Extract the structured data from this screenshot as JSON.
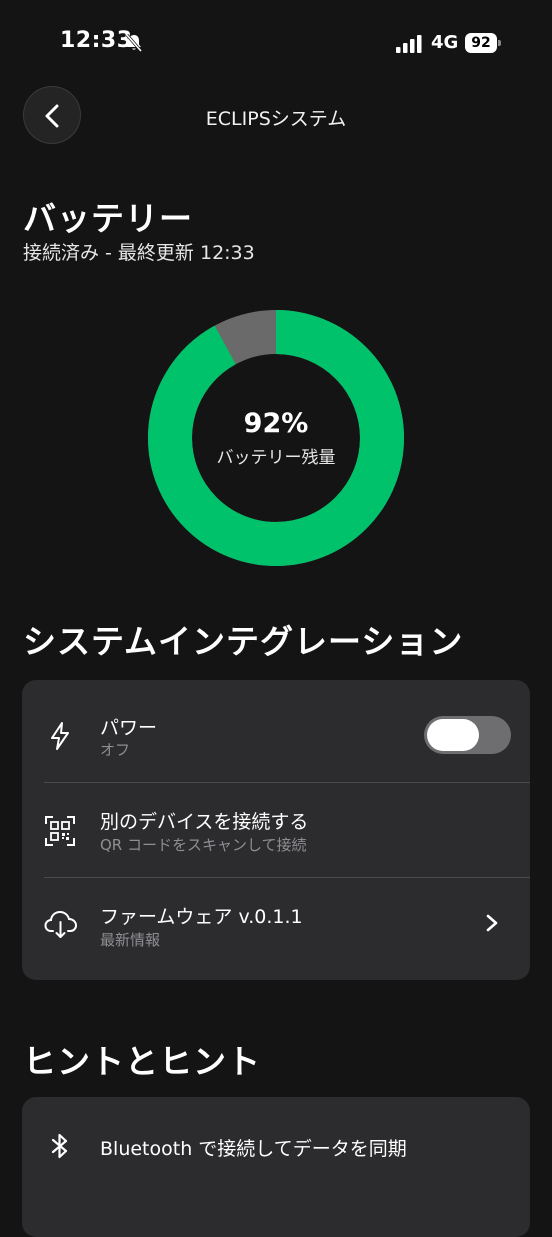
{
  "status_bar": {
    "time": "12:33",
    "network": "4G",
    "battery_level": "92"
  },
  "header": {
    "title": "ECLIPSシステム"
  },
  "battery": {
    "heading": "バッテリー",
    "subtitle": "接続済み - 最終更新 12:33",
    "percent_text": "92%",
    "percent_value": 92,
    "label": "バッテリー残量",
    "colors": {
      "fill": "#00c26a",
      "remaining": "#6a6a6a",
      "center": "#141414"
    }
  },
  "integration": {
    "heading": "システムインテグレーション",
    "power": {
      "icon": "lightning-icon",
      "title": "パワー",
      "status": "オフ",
      "toggle_on": false
    },
    "connect": {
      "icon": "qr-code-icon",
      "title": "別のデバイスを接続する",
      "subtitle": "QR コードをスキャンして接続"
    },
    "firmware": {
      "icon": "cloud-download-icon",
      "title": "ファームウェア v.0.1.1",
      "subtitle": "最新情報"
    }
  },
  "tips": {
    "heading": "ヒントとヒント",
    "items": [
      {
        "icon": "bluetooth-icon",
        "text": "Bluetooth で接続してデータを同期"
      }
    ]
  }
}
